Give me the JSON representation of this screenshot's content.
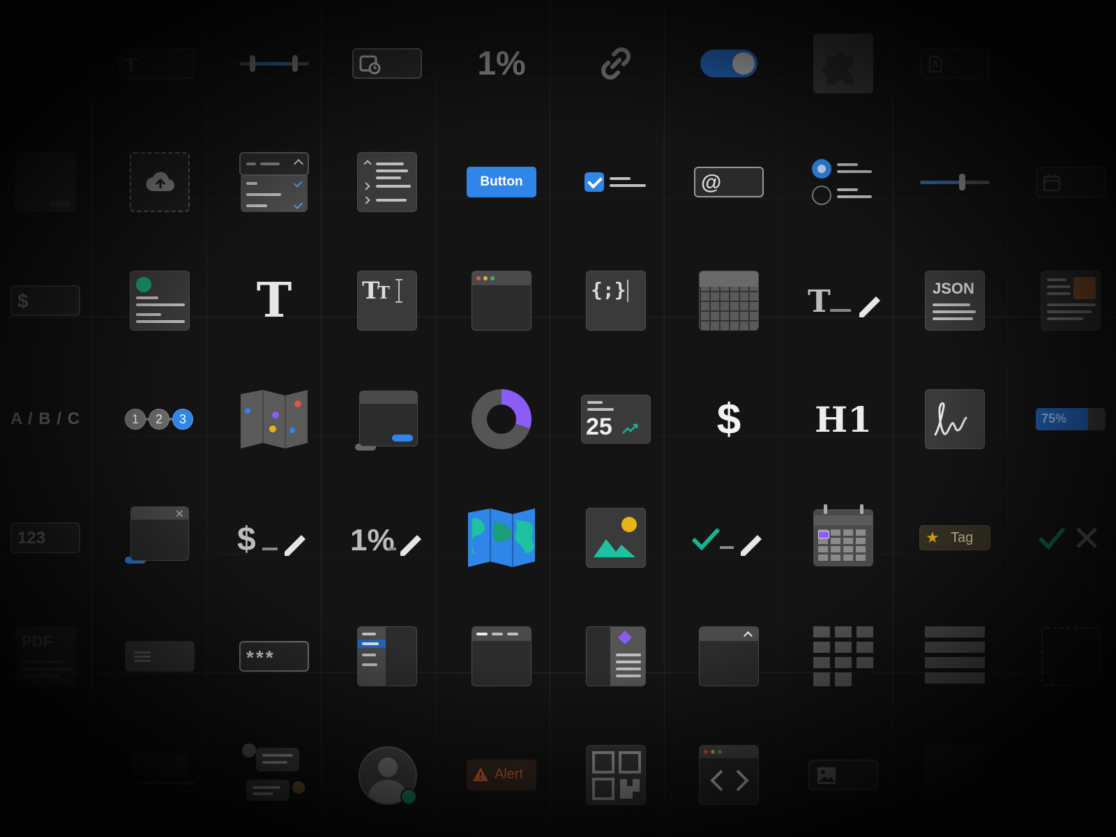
{
  "labels": {
    "percent": "1%",
    "button": "Button",
    "at": "@",
    "dollar": "$",
    "json": "JSON",
    "abc": "A / B / C",
    "step1": "1",
    "step2": "2",
    "step3": "3",
    "stat_number": "25",
    "h1": "H1",
    "progress": "75%",
    "number_input": "123",
    "dollar_edit": "$",
    "percent_edit": "1%",
    "tag": "Tag",
    "pdf": "PDF",
    "password": "***",
    "alert": "Alert"
  },
  "progress_value": 0.75,
  "donut_fraction": 0.3,
  "colors": {
    "accent": "#2f86e8",
    "purple": "#8b5cf6",
    "green": "#19b38f",
    "gold": "#e8b21a",
    "alert": "#e0642c"
  }
}
